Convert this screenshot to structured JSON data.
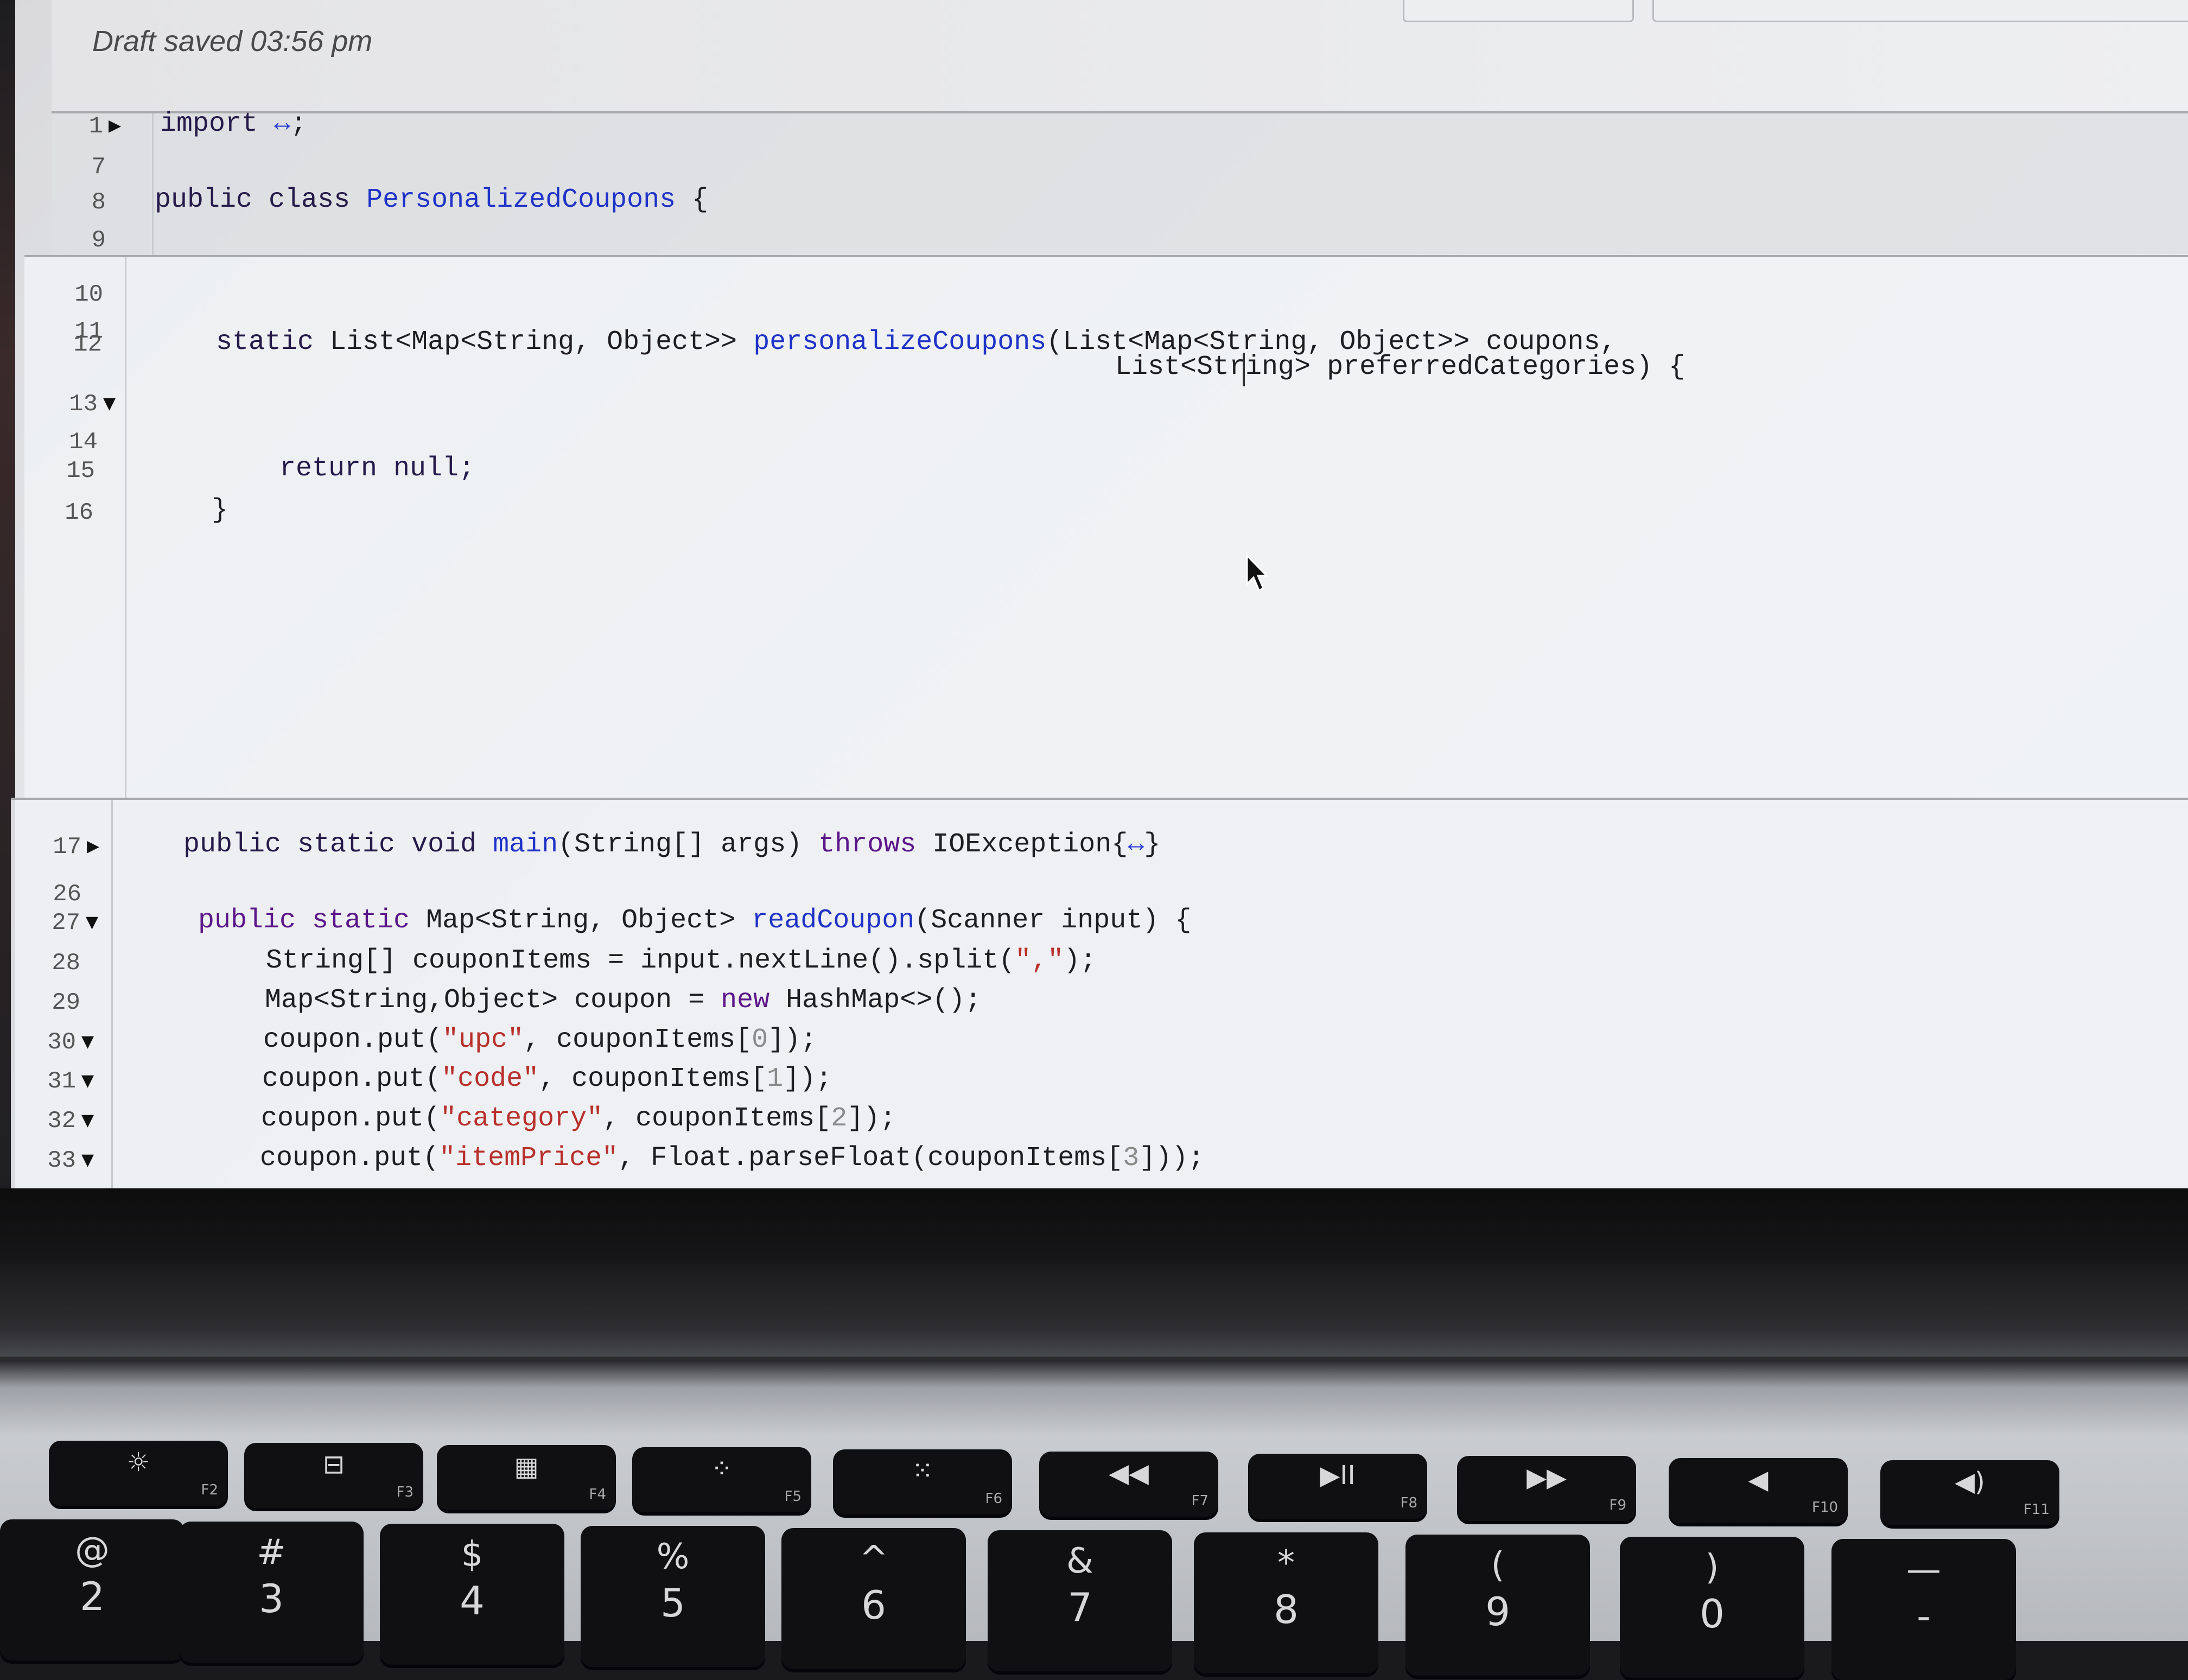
{
  "editor": {
    "draft_status": "Draft saved 03:56 pm",
    "lines": {
      "l1": {
        "num": "1",
        "fold": "▶",
        "code": [
          {
            "t": "import ",
            "c": "kw"
          },
          {
            "t": "↔",
            "c": "ell"
          },
          {
            "t": ";",
            "c": "type"
          }
        ]
      },
      "l7": {
        "num": "7",
        "fold": "",
        "code": []
      },
      "l8": {
        "num": "8",
        "fold": "",
        "code": [
          {
            "t": "public class ",
            "c": "kw"
          },
          {
            "t": "PersonalizedCoupons",
            "c": "name"
          },
          {
            "t": " {",
            "c": "type"
          }
        ]
      },
      "l9": {
        "num": "9",
        "fold": "",
        "code": []
      },
      "l10": {
        "num": "10",
        "fold": "",
        "code": []
      },
      "l11": {
        "num": "11",
        "fold": "",
        "code": []
      },
      "l12": {
        "num": "12",
        "fold": "",
        "code": [
          {
            "t": "static ",
            "c": "kw"
          },
          {
            "t": "List<Map<String, Object>> ",
            "c": "type"
          },
          {
            "t": "personalizeCoupons",
            "c": "name"
          },
          {
            "t": "(List<Map<String, Object>> coupons,",
            "c": "type"
          }
        ]
      },
      "l12b": {
        "num": "",
        "fold": "",
        "code": [
          {
            "t": "List<String> preferredCategories) {",
            "c": "type"
          }
        ]
      },
      "l13": {
        "num": "13",
        "fold": "▼",
        "code": []
      },
      "l14": {
        "num": "14",
        "fold": "",
        "code": []
      },
      "l15": {
        "num": "15",
        "fold": "",
        "code": [
          {
            "t": "return null;",
            "c": "kw"
          }
        ]
      },
      "l16": {
        "num": "16",
        "fold": "",
        "code": [
          {
            "t": "}",
            "c": "type"
          }
        ]
      },
      "l17": {
        "num": "17",
        "fold": "▶",
        "code": [
          {
            "t": "public static void ",
            "c": "kw"
          },
          {
            "t": "main",
            "c": "name"
          },
          {
            "t": "(String[] args) ",
            "c": "type"
          },
          {
            "t": "throws ",
            "c": "kw2"
          },
          {
            "t": "IOException{",
            "c": "type"
          },
          {
            "t": "↔",
            "c": "ell"
          },
          {
            "t": "}",
            "c": "type"
          }
        ]
      },
      "l26": {
        "num": "26",
        "fold": "",
        "code": []
      },
      "l27": {
        "num": "27",
        "fold": "▼",
        "code": [
          {
            "t": "public static ",
            "c": "kw2"
          },
          {
            "t": "Map<String, Object> ",
            "c": "type"
          },
          {
            "t": "readCoupon",
            "c": "name"
          },
          {
            "t": "(Scanner input) {",
            "c": "type"
          }
        ]
      },
      "l28": {
        "num": "28",
        "fold": "",
        "code": [
          {
            "t": "String[] couponItems = input.nextLine().split(",
            "c": "type"
          },
          {
            "t": "\",\"",
            "c": "str"
          },
          {
            "t": ");",
            "c": "type"
          }
        ]
      },
      "l29": {
        "num": "29",
        "fold": "",
        "code": [
          {
            "t": "Map<String,Object> coupon = ",
            "c": "type"
          },
          {
            "t": "new ",
            "c": "kw2"
          },
          {
            "t": "HashMap<>();",
            "c": "type"
          }
        ]
      },
      "l30": {
        "num": "30",
        "fold": "▼",
        "code": [
          {
            "t": "coupon.put(",
            "c": "type"
          },
          {
            "t": "\"upc\"",
            "c": "str"
          },
          {
            "t": ", couponItems[",
            "c": "type"
          },
          {
            "t": "0",
            "c": "num"
          },
          {
            "t": "]);",
            "c": "type"
          }
        ]
      },
      "l31": {
        "num": "31",
        "fold": "▼",
        "code": [
          {
            "t": "coupon.put(",
            "c": "type"
          },
          {
            "t": "\"code\"",
            "c": "str"
          },
          {
            "t": ", couponItems[",
            "c": "type"
          },
          {
            "t": "1",
            "c": "num"
          },
          {
            "t": "]);",
            "c": "type"
          }
        ]
      },
      "l32": {
        "num": "32",
        "fold": "▼",
        "code": [
          {
            "t": "coupon.put(",
            "c": "type"
          },
          {
            "t": "\"category\"",
            "c": "str"
          },
          {
            "t": ", couponItems[",
            "c": "type"
          },
          {
            "t": "2",
            "c": "num"
          },
          {
            "t": "]);",
            "c": "type"
          }
        ]
      },
      "l33": {
        "num": "33",
        "fold": "▼",
        "code": [
          {
            "t": "coupon.put(",
            "c": "type"
          },
          {
            "t": "\"itemPrice\"",
            "c": "str"
          },
          {
            "t": ", Float.parseFloat(couponItems[",
            "c": "type"
          },
          {
            "t": "3",
            "c": "num"
          },
          {
            "t": "]));",
            "c": "type"
          }
        ]
      }
    }
  },
  "keyboard": {
    "fn_keys": [
      {
        "sym": "☼",
        "sub": "F2"
      },
      {
        "sym": "⊟",
        "sub": "F3"
      },
      {
        "sym": "▦",
        "sub": "F4"
      },
      {
        "sym": "⁘",
        "sub": "F5"
      },
      {
        "sym": "⁙",
        "sub": "F6"
      },
      {
        "sym": "◀◀",
        "sub": "F7"
      },
      {
        "sym": "▶II",
        "sub": "F8"
      },
      {
        "sym": "▶▶",
        "sub": "F9"
      },
      {
        "sym": "◀",
        "sub": "F10"
      },
      {
        "sym": "◀)",
        "sub": "F11"
      }
    ],
    "num_keys": [
      {
        "top": "@",
        "bottom": "2"
      },
      {
        "top": "#",
        "bottom": "3"
      },
      {
        "top": "$",
        "bottom": "4"
      },
      {
        "top": "%",
        "bottom": "5"
      },
      {
        "top": "^",
        "bottom": "6"
      },
      {
        "top": "&",
        "bottom": "7"
      },
      {
        "top": "*",
        "bottom": "8"
      },
      {
        "top": "(",
        "bottom": "9"
      },
      {
        "top": ")",
        "bottom": "0"
      },
      {
        "top": "—",
        "bottom": "-"
      }
    ]
  }
}
